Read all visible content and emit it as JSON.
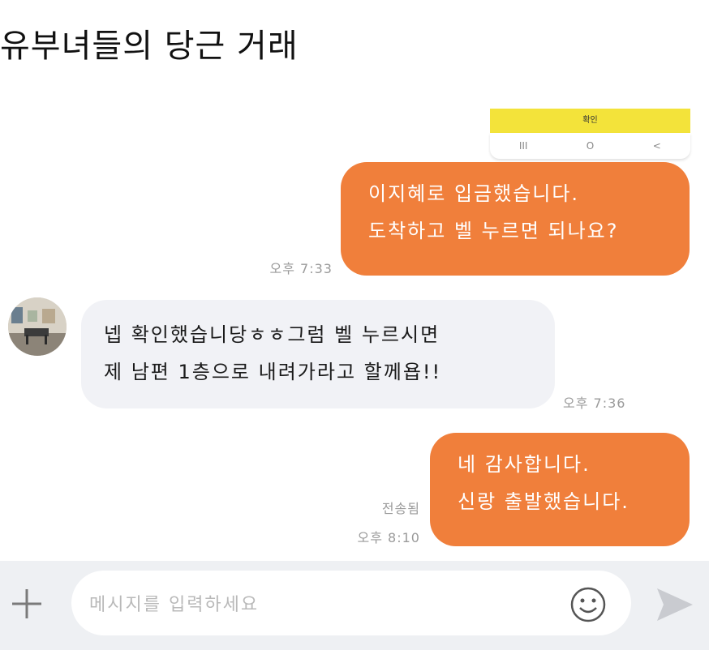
{
  "title": "유부녀들의 당근 거래",
  "confirm_label": "확인",
  "nav": {
    "recent_glyph": "III",
    "home_glyph": "O",
    "back_glyph": "<"
  },
  "messages": [
    {
      "id": "m1",
      "direction": "outgoing",
      "lines": [
        "이지혜로 입금했습니다.",
        "도착하고 벨 누르면 되나요?"
      ],
      "time": "오후 7:33"
    },
    {
      "id": "m2",
      "direction": "incoming",
      "lines": [
        "넵 확인했습니당ㅎㅎ그럼 벨 누르시면",
        "제 남편 1층으로 내려가라고 할께욥!!"
      ],
      "time": "오후 7:36"
    },
    {
      "id": "m3",
      "direction": "outgoing",
      "lines": [
        "네 감사합니다.",
        "신랑 출발했습니다."
      ],
      "status": "전송됨",
      "time": "오후 8:10"
    }
  ],
  "composer": {
    "placeholder": "메시지를 입력하세요"
  },
  "colors": {
    "outgoing_bubble": "#f07f3b",
    "incoming_bubble": "#f1f2f6",
    "confirm_bar": "#f3e33a",
    "input_bar": "#eef0f3"
  }
}
